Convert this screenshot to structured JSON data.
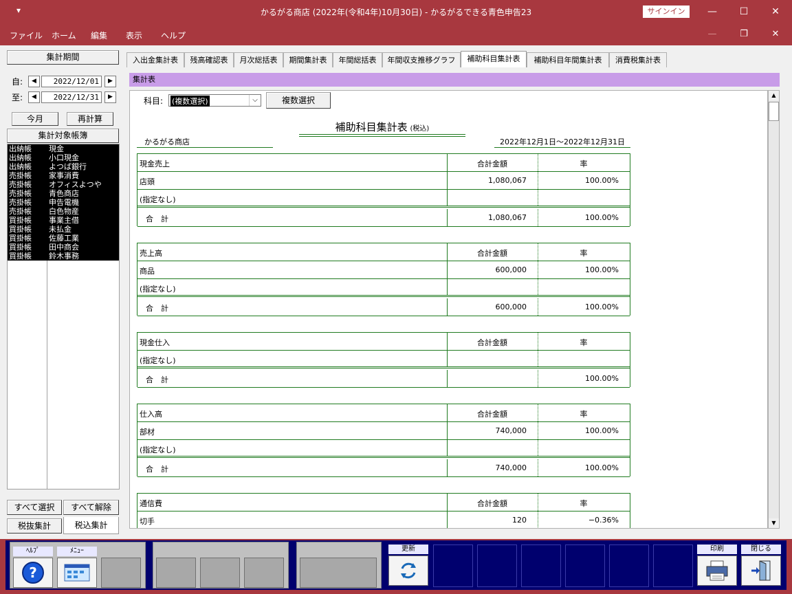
{
  "window": {
    "title": "かるがる商店 (2022年(令和4年)10月30日)  -  かるがるできる青色申告23",
    "sysmenu": "▾",
    "signin": "サインイン",
    "minimize": "—",
    "maximize": "☐",
    "close": "✕",
    "mdi_restore": "❐",
    "mdi_close": "✕",
    "mdi_min": "—"
  },
  "menu": [
    "ファイル",
    "ホーム",
    "編集",
    "表示",
    "ヘルプ"
  ],
  "left": {
    "period_label": "集計期間",
    "from_label": "自:",
    "to_label": "至:",
    "from_date": "2022/12/01",
    "to_date": "2022/12/31",
    "this_month": "今月",
    "recalc": "再計算",
    "ledger_label": "集計対象帳簿",
    "ledgers": [
      [
        "出納帳",
        "現金"
      ],
      [
        "出納帳",
        "小口現金"
      ],
      [
        "出納帳",
        "よつば銀行"
      ],
      [
        "売掛帳",
        "家事消費"
      ],
      [
        "売掛帳",
        "オフィスよつや"
      ],
      [
        "売掛帳",
        "青色商店"
      ],
      [
        "売掛帳",
        "申告電機"
      ],
      [
        "売掛帳",
        "白色物産"
      ],
      [
        "買掛帳",
        "事業主借"
      ],
      [
        "買掛帳",
        "未払金"
      ],
      [
        "買掛帳",
        "佐藤工業"
      ],
      [
        "買掛帳",
        "田中商会"
      ],
      [
        "買掛帳",
        "鈴木事務"
      ]
    ],
    "select_all": "すべて選択",
    "deselect_all": "すべて解除",
    "tax_excl": "税抜集計",
    "tax_incl": "税込集計"
  },
  "tabs": [
    "入出金集計表",
    "残高確認表",
    "月次総括表",
    "期間集計表",
    "年間総括表",
    "年間収支推移グラフ",
    "補助科目集計表",
    "補助科目年間集計表",
    "消費税集計表"
  ],
  "panel_title": "集計表",
  "report": {
    "subject_label": "科目:",
    "subject_value": "(複数選択)",
    "multi_select": "複数選択",
    "title": "補助科目集計表",
    "title_note": "(税込)",
    "company": "かるがる商店",
    "period": "2022年12月1日～2022年12月31日",
    "col_amount": "合計金額",
    "col_rate": "率",
    "sections": [
      {
        "name": "現金売上",
        "rows": [
          [
            "店頭",
            "1,080,067",
            "100.00%"
          ],
          [
            "(指定なし)",
            "",
            ""
          ]
        ],
        "total": [
          "合　計",
          "1,080,067",
          "100.00%"
        ]
      },
      {
        "name": "売上高",
        "rows": [
          [
            "商品",
            "600,000",
            "100.00%"
          ],
          [
            "(指定なし)",
            "",
            ""
          ]
        ],
        "total": [
          "合　計",
          "600,000",
          "100.00%"
        ]
      },
      {
        "name": "現金仕入",
        "rows": [
          [
            "(指定なし)",
            "",
            ""
          ]
        ],
        "total": [
          "合　計",
          "",
          "100.00%"
        ]
      },
      {
        "name": "仕入高",
        "rows": [
          [
            "部材",
            "740,000",
            "100.00%"
          ],
          [
            "(指定なし)",
            "",
            ""
          ]
        ],
        "total": [
          "合　計",
          "740,000",
          "100.00%"
        ]
      },
      {
        "name": "通信費",
        "rows": [
          [
            "切手",
            "120",
            "−0.36%"
          ]
        ],
        "total": null
      }
    ]
  },
  "footer": {
    "help": "ﾍﾙﾌﾟ",
    "menu": "ﾒﾆｭｰ",
    "refresh": "更新",
    "print": "印刷",
    "close": "閉じる"
  }
}
